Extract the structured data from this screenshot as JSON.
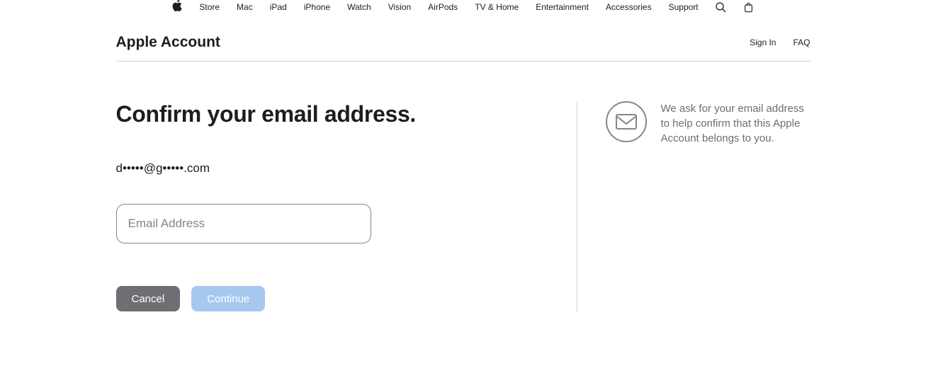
{
  "globalNav": {
    "items": [
      "Store",
      "Mac",
      "iPad",
      "iPhone",
      "Watch",
      "Vision",
      "AirPods",
      "TV & Home",
      "Entertainment",
      "Accessories",
      "Support"
    ]
  },
  "subheader": {
    "title": "Apple Account",
    "links": [
      "Sign In",
      "FAQ"
    ]
  },
  "main": {
    "heading": "Confirm your email address.",
    "maskedEmail": "d•••••@g•••••.com",
    "emailPlaceholder": "Email Address",
    "emailValue": "",
    "cancelLabel": "Cancel",
    "continueLabel": "Continue"
  },
  "help": {
    "text": "We ask for your email address to help confirm that this Apple Account belongs to you."
  }
}
